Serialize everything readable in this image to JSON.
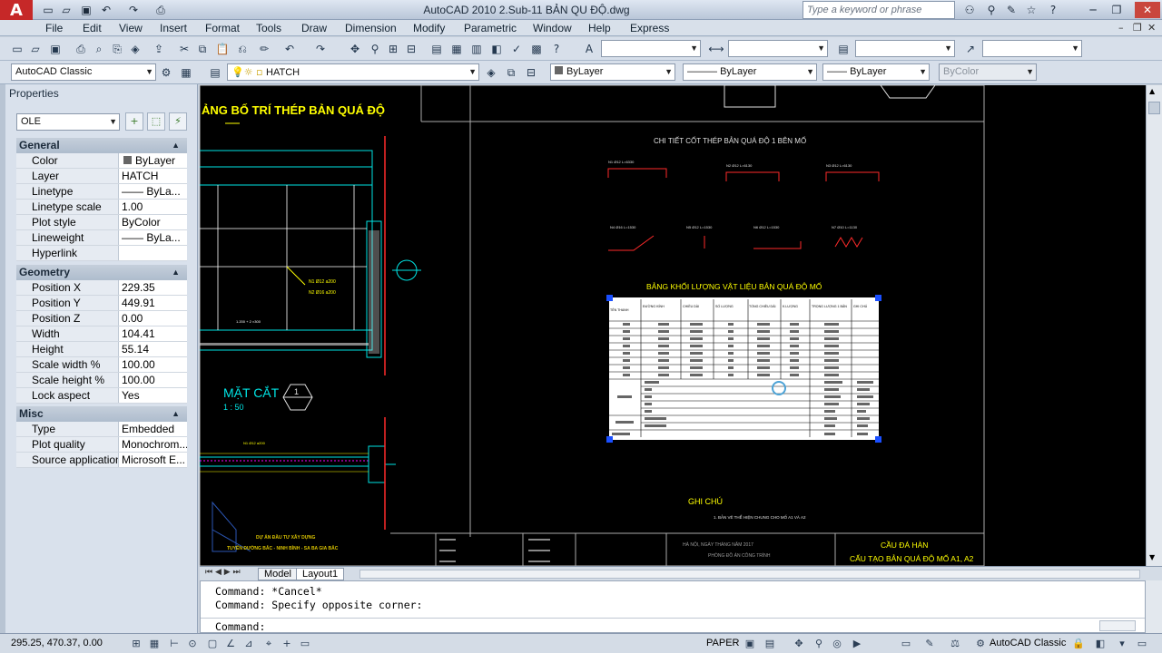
{
  "app": {
    "logo": "A",
    "title": "AutoCAD 2010     2.Sub-11 BẢN QU     ĐỘ.dwg"
  },
  "search": {
    "placeholder": "Type a keyword or phrase"
  },
  "menus": [
    "File",
    "Edit",
    "View",
    "Insert",
    "Format",
    "Tools",
    "Draw",
    "Dimension",
    "Modify",
    "Parametric",
    "Window",
    "Help",
    "Express"
  ],
  "toolbar": {
    "workspace": "AutoCAD Classic",
    "layer": "HATCH",
    "color": "ByLayer",
    "linetype": "ByLayer",
    "lineweight": "ByLayer",
    "plotstyle": "ByColor"
  },
  "properties": {
    "title": "Properties",
    "object": "OLE",
    "sections": [
      {
        "name": "General",
        "rows": [
          {
            "k": "Color",
            "v": "ByLayer"
          },
          {
            "k": "Layer",
            "v": "HATCH"
          },
          {
            "k": "Linetype",
            "v": "—— ByLa..."
          },
          {
            "k": "Linetype scale",
            "v": "1.00"
          },
          {
            "k": "Plot style",
            "v": "ByColor"
          },
          {
            "k": "Lineweight",
            "v": "—— ByLa..."
          },
          {
            "k": "Hyperlink",
            "v": ""
          }
        ]
      },
      {
        "name": "Geometry",
        "rows": [
          {
            "k": "Position X",
            "v": "229.35"
          },
          {
            "k": "Position Y",
            "v": "449.91"
          },
          {
            "k": "Position Z",
            "v": "0.00"
          },
          {
            "k": "Width",
            "v": "104.41"
          },
          {
            "k": "Height",
            "v": "55.14"
          },
          {
            "k": "Scale width  %",
            "v": "100.00"
          },
          {
            "k": "Scale height %",
            "v": "100.00"
          },
          {
            "k": "Lock aspect",
            "v": "Yes"
          }
        ]
      },
      {
        "name": "Misc",
        "rows": [
          {
            "k": "Type",
            "v": "Embedded"
          },
          {
            "k": "Plot quality",
            "v": "Monochrom..."
          },
          {
            "k": "Source application",
            "v": "Microsoft E..."
          }
        ]
      }
    ]
  },
  "drawing": {
    "title_left": "ẢNG BỐ TRÍ THÉP BẢN QUÁ ĐỘ",
    "detail_title": "CHI TIẾT CỐT THÉP BẢN QUÁ ĐỘ 1 BÊN MỐ",
    "table_title": "BẢNG KHỐI LƯỢNG VẬT LIỆU BẢN QUÁ ĐỘ MỐ",
    "section_label": "MẶT CẮT",
    "section_scale": "1 : 50",
    "section_number": "1",
    "notes_title": "GHI CHÚ",
    "notes_text": "1. BẢN VẼ THỂ HIỆN CHUNG CHO MỐ A1 VÀ A2",
    "titleblock_bridge": "CẦU ĐÁ HÀN",
    "titleblock_sheet": "CẤU TẠO BẢN QUÁ ĐỘ MỐ A1, A2",
    "titleblock_date": "HÀ NỘI, NGÀY    THÁNG    NĂM 2017",
    "titleblock_company": "PHÒNG ĐỒ ÁN CÔNG TRÌNH",
    "titleblock_project": "TUYẾN ĐƯỜNG BẮC - NINH BÌNH - SA BA GIA BẮC"
  },
  "table_cols": [
    "TÊN THANH",
    "ĐƯỜNG KÍNH",
    "CHIỀU DÀI",
    "SỐ LƯỢNG",
    "TỔNG CHIỀU DÀI",
    "K.LƯỢNG",
    "TRỌNG LƯỢNG 1 BẢN",
    "GHI CHÚ"
  ],
  "tabs": [
    "Model",
    "Layout1"
  ],
  "command": {
    "line1": "Command: *Cancel*",
    "line2": "Command: Specify opposite corner:",
    "prompt": "Command:"
  },
  "status": {
    "coords": "295.25, 470.37, 0.00",
    "paper": "PAPER",
    "workspace": "AutoCAD Classic"
  },
  "colors": {
    "canvas": "#000000",
    "cyan": "#00e5e5",
    "yellow": "#ffff00",
    "red": "#ff2a2a",
    "magenta": "#ff00ff",
    "grip": "#1a4fff"
  }
}
